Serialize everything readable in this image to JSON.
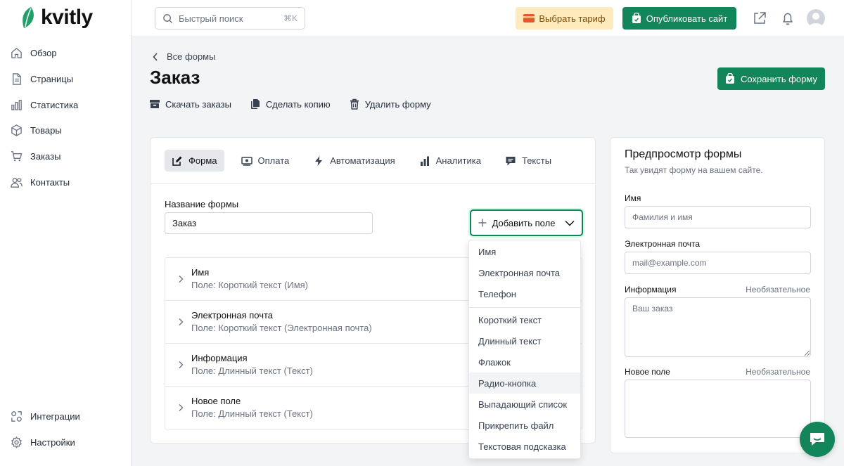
{
  "brand": {
    "name": "kvitly",
    "accent": "#13855b"
  },
  "sidebar": {
    "items": [
      {
        "label": "Обзор",
        "icon": "home-icon"
      },
      {
        "label": "Страницы",
        "icon": "page-icon"
      },
      {
        "label": "Статистика",
        "icon": "chart-icon"
      },
      {
        "label": "Товары",
        "icon": "box-icon"
      },
      {
        "label": "Заказы",
        "icon": "cart-icon"
      },
      {
        "label": "Контакты",
        "icon": "users-icon"
      }
    ],
    "bottom": [
      {
        "label": "Интеграции",
        "icon": "integrations-icon"
      },
      {
        "label": "Настройки",
        "icon": "gear-icon"
      }
    ]
  },
  "header": {
    "search_placeholder": "Быстрый поиск",
    "search_shortcut": "⌘K",
    "tariff_label": "Выбрать тариф",
    "publish_label": "Опубликовать сайт"
  },
  "page": {
    "breadcrumb": "Все формы",
    "title": "Заказ",
    "save_label": "Сохранить форму",
    "actions": [
      "Скачать заказы",
      "Сделать копию",
      "Удалить форму"
    ]
  },
  "tabs": [
    {
      "label": "Форма",
      "active": true
    },
    {
      "label": "Оплата"
    },
    {
      "label": "Автоматизация"
    },
    {
      "label": "Аналитика"
    },
    {
      "label": "Тексты"
    }
  ],
  "form": {
    "name_label": "Название формы",
    "name_value": "Заказ",
    "add_field_label": "Добавить поле",
    "fields": [
      {
        "name": "Имя",
        "desc": "Поле: Короткий текст (Имя)"
      },
      {
        "name": "Электронная почта",
        "desc": "Поле: Короткий текст (Электронная почта)"
      },
      {
        "name": "Информация",
        "desc": "Поле: Длинный текст (Текст)"
      },
      {
        "name": "Новое поле",
        "desc": "Поле: Длинный текст (Текст)"
      }
    ]
  },
  "dropdown": {
    "items": [
      "Имя",
      "Электронная почта",
      "Телефон",
      "Короткий текст",
      "Длинный текст",
      "Флажок",
      "Радио-кнопка",
      "Выпадающий список",
      "Прикрепить файл",
      "Текстовая подсказка"
    ],
    "highlighted": "Радио-кнопка"
  },
  "preview": {
    "title": "Предпросмотр формы",
    "subtitle": "Так увидят форму на вашем сайте.",
    "optional_label": "Необязательное",
    "fields": [
      {
        "label": "Имя",
        "placeholder": "Фамилия и имя"
      },
      {
        "label": "Электронная почта",
        "placeholder": "mail@example.com"
      },
      {
        "label": "Информация",
        "placeholder": "Ваш заказ"
      },
      {
        "label": "Новое поле",
        "placeholder": ""
      }
    ]
  }
}
